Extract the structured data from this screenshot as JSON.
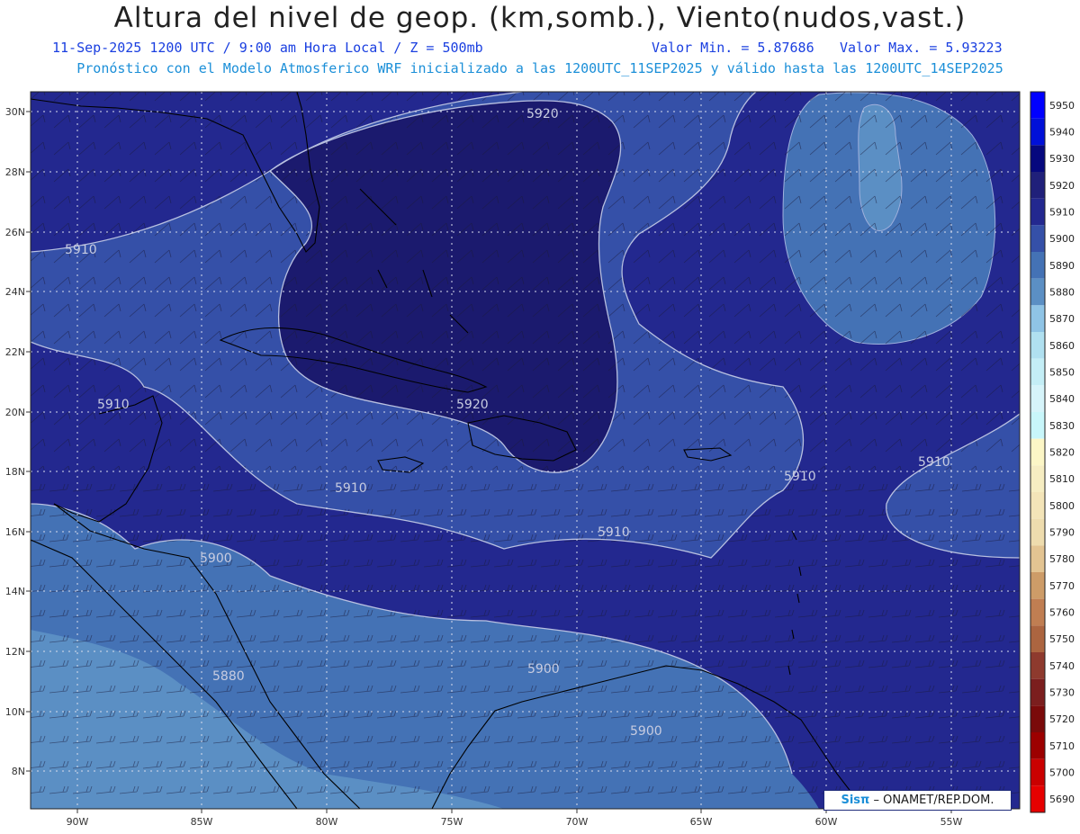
{
  "title": "Altura del nivel de geop. (km,somb.), Viento(nudos,vast.)",
  "subtitle": {
    "datetime": "11-Sep-2025  1200 UTC / 9:00 am Hora Local / Z = 500mb",
    "valmin": "Valor Min. = 5.87686",
    "valmax": "Valor Max. = 5.93223"
  },
  "subtitle2": "Pronóstico con el Modelo Atmosferico WRF inicializado a las 1200UTC_11SEP2025 y válido hasta las  1200UTC_14SEP2025",
  "map": {
    "lat_ticks": [
      "30N",
      "28N",
      "26N",
      "24N",
      "22N",
      "20N",
      "18N",
      "16N",
      "14N",
      "12N",
      "10N",
      "8N"
    ],
    "lon_ticks": [
      "90W",
      "85W",
      "80W",
      "75W",
      "70W",
      "65W",
      "60W",
      "55W"
    ],
    "contour_labels": [
      "5920",
      "5910",
      "5910",
      "5920",
      "5910",
      "5910",
      "5910",
      "5910",
      "5900",
      "5880",
      "5900",
      "5900"
    ]
  },
  "legend": {
    "levels": [
      "5950",
      "5940",
      "5930",
      "5920",
      "5910",
      "5900",
      "5890",
      "5880",
      "5870",
      "5860",
      "5850",
      "5840",
      "5830",
      "5820",
      "5810",
      "5800",
      "5790",
      "5780",
      "5770",
      "5760",
      "5750",
      "5740",
      "5730",
      "5720",
      "5710",
      "5700",
      "5690"
    ],
    "colors": [
      "#0000ff",
      "#0010d8",
      "#06087e",
      "#20207a",
      "#23288f",
      "#3550a8",
      "#4472b5",
      "#5b8fc4",
      "#8fc4e6",
      "#b0e0f0",
      "#c4eef6",
      "#d6f4fa",
      "#c8f6fa",
      "#fcf6c6",
      "#f6edc2",
      "#f3e4b8",
      "#eedcae",
      "#e3c492",
      "#cd9c68",
      "#c07e52",
      "#ac6540",
      "#8e3a2e",
      "#7b1e1e",
      "#7a0a0a",
      "#9c0000",
      "#ca0000",
      "#e60000"
    ],
    "tops": [
      102,
      125,
      150,
      175,
      198,
      220,
      244,
      268,
      292,
      314,
      338,
      360,
      382,
      406,
      428,
      450,
      474,
      496,
      518,
      542,
      566,
      588,
      612,
      634,
      658,
      682,
      704,
      726,
      750,
      774,
      798,
      820,
      844,
      866,
      890,
      912
    ]
  },
  "credit": {
    "sis": "Sisπ",
    "org": "– ONAMET/REP.DOM."
  }
}
